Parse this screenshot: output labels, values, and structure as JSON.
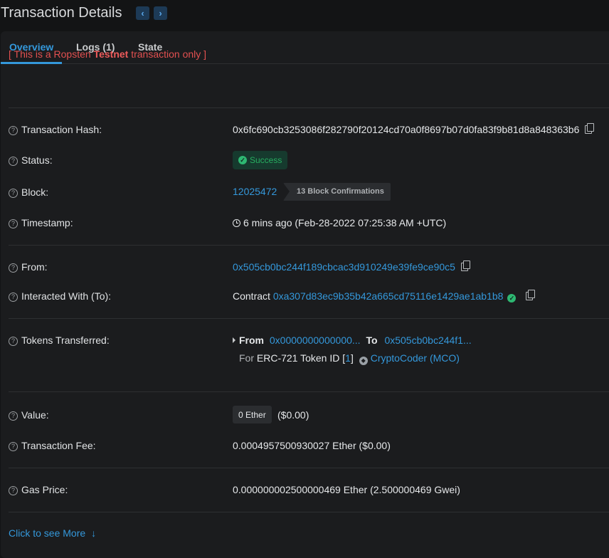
{
  "header": {
    "title": "Transaction Details",
    "prev_icon": "‹",
    "next_icon": "›"
  },
  "tabs": [
    {
      "label": "Overview",
      "active": true
    },
    {
      "label": "Logs (1)",
      "active": false
    },
    {
      "label": "State",
      "active": false
    }
  ],
  "notice": {
    "prefix": "[ This is a Ropsten ",
    "bold": "Testnet",
    "suffix": " transaction only ]"
  },
  "rows": {
    "hash": {
      "label": "Transaction Hash:",
      "value": "0x6fc690cb3253086f282790f20124cd70a0f8697b07d0fa83f9b81d8a848363b6"
    },
    "status": {
      "label": "Status:",
      "value": "Success"
    },
    "block": {
      "label": "Block:",
      "value": "12025472",
      "confirmations": "13 Block Confirmations"
    },
    "timestamp": {
      "label": "Timestamp:",
      "value": "6 mins ago (Feb-28-2022 07:25:38 AM +UTC)"
    },
    "from": {
      "label": "From:",
      "value": "0x505cb0bc244f189cbcac3d910249e39fe9ce90c5"
    },
    "to": {
      "label": "Interacted With (To):",
      "prefix": "Contract",
      "value": "0xa307d83ec9b35b42a665cd75116e1429ae1ab1b8"
    },
    "tokens": {
      "label": "Tokens Transferred:",
      "from_label": "From",
      "from_value": "0x0000000000000...",
      "to_label": "To",
      "to_value": "0x505cb0bc244f1...",
      "for_label": "For",
      "token_type": "ERC-721 Token ID [",
      "token_id": "1",
      "token_close": "]",
      "token_name": "CryptoCoder (MCO)"
    },
    "value": {
      "label": "Value:",
      "badge": "0 Ether",
      "usd": "($0.00)"
    },
    "fee": {
      "label": "Transaction Fee:",
      "value": "0.0004957500930027 Ether ($0.00)"
    },
    "gas": {
      "label": "Gas Price:",
      "value": "0.000000002500000469 Ether (2.500000469 Gwei)"
    }
  },
  "footer": {
    "more": "Click to see More",
    "arrow": "↓"
  },
  "colors": {
    "accent": "#3498db",
    "success": "#2eb872",
    "testnet": "#e25050"
  }
}
